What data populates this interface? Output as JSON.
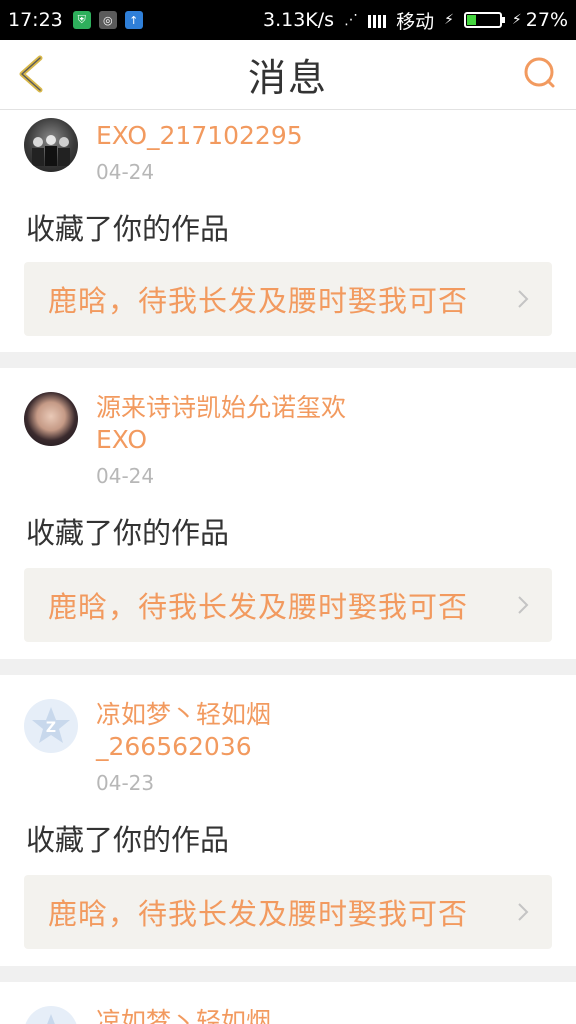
{
  "status_bar": {
    "time": "17:23",
    "net_speed": "3.13K/s",
    "carrier": "移动",
    "battery": "27%",
    "battery_level": 0.27
  },
  "header": {
    "title": "消息",
    "back_icon": "chevron-left-icon",
    "search_icon": "search-icon",
    "accent": "#f29a5f"
  },
  "messages": [
    {
      "user": "EXO_217102295",
      "date": "04-24",
      "action": "收藏了你的作品",
      "work": "鹿晗，待我长发及腰时娶我可否"
    },
    {
      "user": "源来诗诗凯始允诺玺欢EXO",
      "date": "04-24",
      "action": "收藏了你的作品",
      "work": "鹿晗，待我长发及腰时娶我可否"
    },
    {
      "user": "凉如梦丶轻如烟_266562036",
      "date": "04-23",
      "action": "收藏了你的作品",
      "work": "鹿晗，待我长发及腰时娶我可否"
    },
    {
      "user": "凉如梦丶轻如烟"
    }
  ]
}
